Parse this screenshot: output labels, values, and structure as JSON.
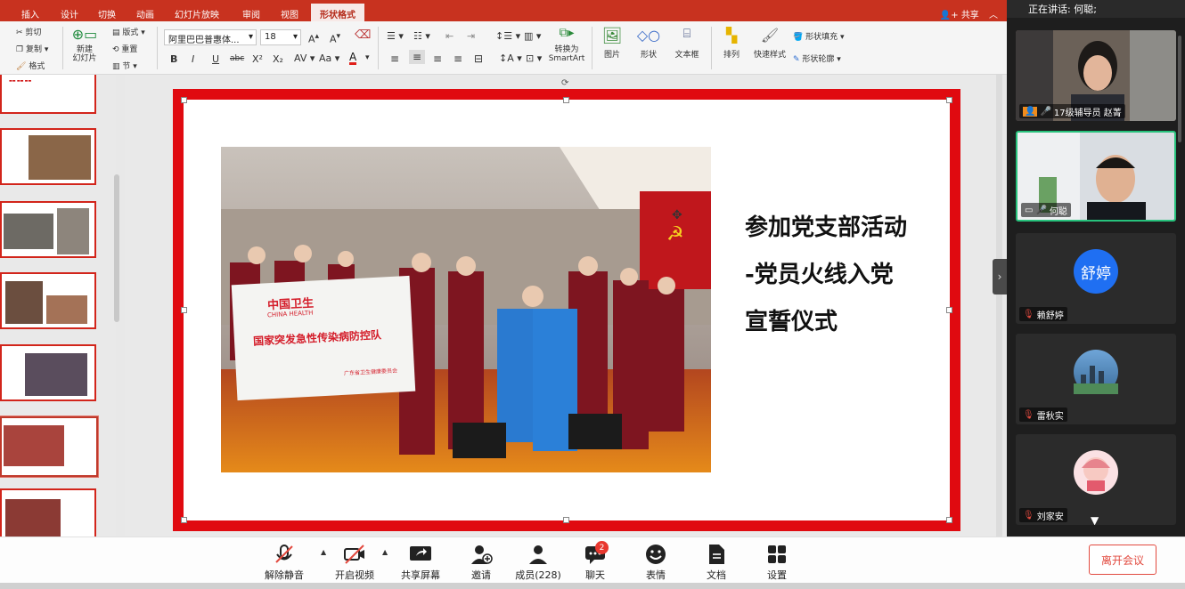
{
  "ribbon_tabs": [
    "插入",
    "设计",
    "切换",
    "动画",
    "幻灯片放映",
    "审阅",
    "视图",
    "形状格式"
  ],
  "share_label": "共享",
  "clipboard": {
    "cut": "剪切",
    "copy": "复制",
    "format": "格式"
  },
  "slides_group": {
    "new_slide": "新建\n幻灯片",
    "layout": "版式",
    "reset": "重置",
    "section": "节"
  },
  "font": {
    "name": "阿里巴巴普惠体...",
    "size": "18"
  },
  "format_buttons": {
    "bold": "B",
    "italic": "I",
    "underline": "U",
    "strike": "abc",
    "sup": "X²",
    "sub": "X₂"
  },
  "smartart_label": "转换为\nSmartArt",
  "insert_group": {
    "picture": "图片",
    "shape": "形状",
    "textbox": "文本框",
    "arrange": "排列",
    "quick_style": "快速样式",
    "fill": "形状填充",
    "outline": "形状轮廓"
  },
  "slide": {
    "title_lines": [
      "参加党支部活动",
      "-党员火线入党",
      "宣誓仪式"
    ],
    "banner_line1": "中国卫生",
    "banner_line2": "CHINA HEALTH",
    "banner_line3": "国家突发急性传染病防控队",
    "banner_line4": "广东省卫生健康委员会"
  },
  "meeting": {
    "speaking_label": "正在讲话: 何聪;",
    "participants": [
      {
        "name": "17级辅导员 赵菁",
        "kind": "video"
      },
      {
        "name": "何聪",
        "kind": "video"
      },
      {
        "name": "赖舒婷",
        "kind": "avatar",
        "initials": "舒婷",
        "color": "#1f6ff2"
      },
      {
        "name": "雷秋实",
        "kind": "avatar-photo"
      },
      {
        "name": "刘家安",
        "kind": "avatar-cartoon"
      }
    ]
  },
  "toolbar": {
    "mute": "解除静音",
    "video": "开启视频",
    "share_screen": "共享屏幕",
    "invite": "邀请",
    "members": "成员(228)",
    "chat": "聊天",
    "chat_badge": "2",
    "reactions": "表情",
    "docs": "文档",
    "settings": "设置",
    "leave": "离开会议"
  }
}
